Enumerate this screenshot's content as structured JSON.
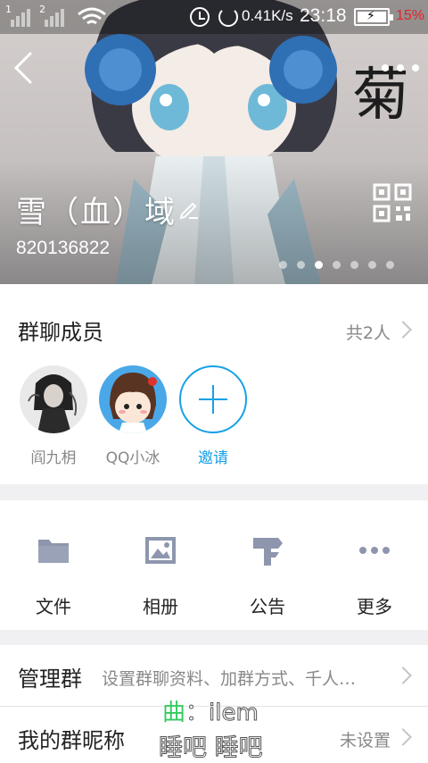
{
  "status_bar": {
    "sim1": "1",
    "sim2": "2",
    "speed": "0.41K/s",
    "time": "23:18",
    "battery_pct": "15%",
    "battery_level": 0.15,
    "battery_color": "#e4222a"
  },
  "header": {
    "group_name": "雪（血）域",
    "group_id": "820136822",
    "banner_art_text": "菊",
    "page_count": 7,
    "active_page": 2,
    "icons": {
      "back": "back-arrow-icon",
      "more": "more-dots-icon",
      "edit": "pencil-icon",
      "qr": "qr-code-icon"
    }
  },
  "members": {
    "title": "群聊成员",
    "count": "共2人",
    "list": [
      {
        "name": "阎九枂"
      },
      {
        "name": "QQ小冰"
      }
    ],
    "invite_label": "邀请",
    "accent": "#16a1e6"
  },
  "functions": [
    {
      "label": "文件",
      "icon": "folder-icon"
    },
    {
      "label": "相册",
      "icon": "photo-album-icon"
    },
    {
      "label": "公告",
      "icon": "signpost-icon"
    },
    {
      "label": "更多",
      "icon": "more-dots-icon"
    }
  ],
  "settings": {
    "manage": {
      "title": "管理群",
      "value": "设置群聊资料、加群方式、千人…"
    },
    "nickname": {
      "title": "我的群昵称",
      "value": "未设置"
    }
  },
  "watermark": {
    "line1_prefix": "曲",
    "line1_rest": "：ilem",
    "line2": "睡吧 睡吧"
  }
}
